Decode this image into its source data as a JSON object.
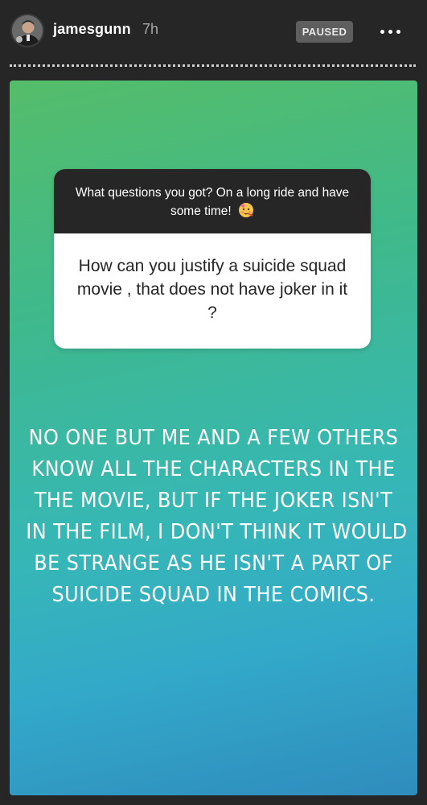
{
  "header": {
    "username": "jamesgunn",
    "timestamp": "7h",
    "status_badge": "PAUSED",
    "more_icon": "more-horizontal-icon"
  },
  "question_card": {
    "prompt": "What questions you got? On a long ride and have some time!",
    "prompt_emoji": "face-with-party-horn-icon",
    "answer": "How can you justify a suicide squad movie , that does not have joker in it ?"
  },
  "caption_lines": [
    "NO ONE BUT ME AND A FEW OTHERS",
    "KNOW ALL THE CHARACTERS IN THE",
    "THE MOVIE, BUT IF THE JOKER ISN'T",
    "IN THE FILM, I DON'T THINK IT WOULD",
    "BE STRANGE AS HE ISN'T A PART OF",
    "SUICIDE SQUAD IN  THE COMICS."
  ],
  "colors": {
    "gradient_top": "#55bd6a",
    "gradient_bottom": "#2f8cbd",
    "card_header": "#262626"
  }
}
